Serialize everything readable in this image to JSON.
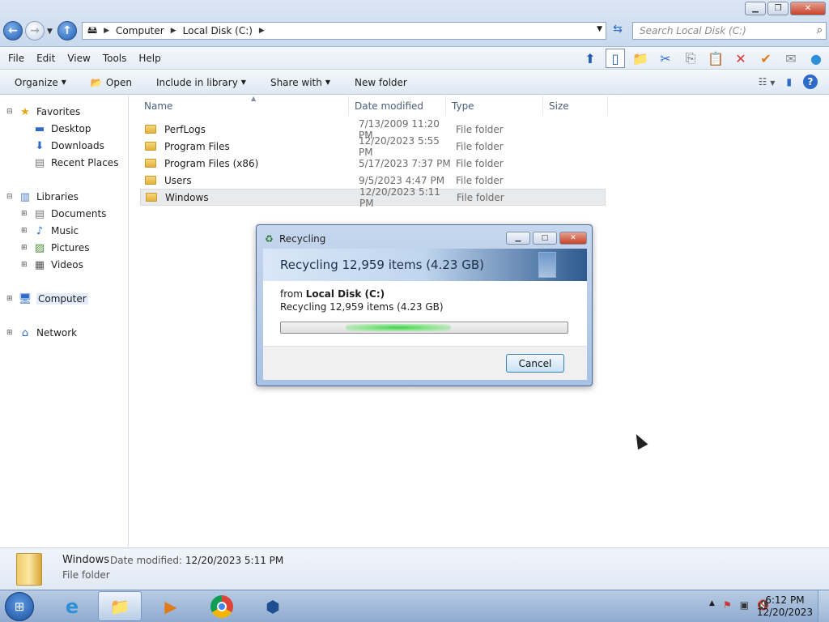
{
  "window": {
    "address": {
      "crumbs": [
        "Computer",
        "Local Disk (C:)"
      ]
    },
    "search_placeholder": "Search Local Disk (C:)"
  },
  "menubar": {
    "items": [
      "File",
      "Edit",
      "View",
      "Tools",
      "Help"
    ]
  },
  "commandbar": {
    "organize": "Organize",
    "open": "Open",
    "include_in_library": "Include in library",
    "share_with": "Share with",
    "new_folder": "New folder"
  },
  "navigation": {
    "favorites": "Favorites",
    "desktop": "Desktop",
    "downloads": "Downloads",
    "recent_places": "Recent Places",
    "libraries": "Libraries",
    "documents": "Documents",
    "music": "Music",
    "pictures": "Pictures",
    "videos": "Videos",
    "computer": "Computer",
    "network": "Network"
  },
  "filelist": {
    "columns": {
      "name": "Name",
      "date_modified": "Date modified",
      "type": "Type",
      "size": "Size"
    },
    "rows": [
      {
        "name": "PerfLogs",
        "date": "7/13/2009 11:20 PM",
        "type": "File folder"
      },
      {
        "name": "Program Files",
        "date": "12/20/2023 5:55 PM",
        "type": "File folder"
      },
      {
        "name": "Program Files (x86)",
        "date": "5/17/2023 7:37 PM",
        "type": "File folder"
      },
      {
        "name": "Users",
        "date": "9/5/2023 4:47 PM",
        "type": "File folder"
      },
      {
        "name": "Windows",
        "date": "12/20/2023 5:11 PM",
        "type": "File folder"
      }
    ],
    "selected_index": 4
  },
  "details": {
    "name": "Windows",
    "date_modified_label": "Date modified:",
    "date_modified_value": "12/20/2023 5:11 PM",
    "type": "File folder"
  },
  "dialog": {
    "title": "Recycling",
    "heading": "Recycling 12,959 items (4.23 GB)",
    "from_label": "from",
    "from_location": "Local Disk (C:)",
    "status": "Recycling 12,959 items (4.23 GB)",
    "cancel": "Cancel",
    "progress_style": "indeterminate"
  },
  "taskbar": {
    "apps": [
      "start",
      "internet-explorer",
      "windows-explorer",
      "media-player",
      "chrome",
      "virtualbox"
    ],
    "active_app": "windows-explorer",
    "time": "6:12 PM",
    "date": "12/20/2023"
  }
}
